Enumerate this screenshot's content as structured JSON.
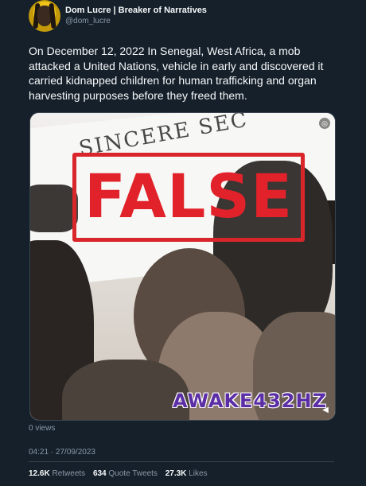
{
  "author": {
    "display_name": "Dom Lucre | Breaker of Narratives",
    "handle": "@dom_lucre"
  },
  "tweet": {
    "text": "On December 12, 2022 In Senegal, West Africa, a mob attacked a United Nations, vehicle in early and discovered it carried kidnapped children for human trafficking and organ harvesting purposes before they freed them."
  },
  "media": {
    "stamp_text": "FALSE",
    "watermark_text": "AWAKE432HZ",
    "background_sign_text": "SINCERE SEC",
    "stamp_color": "#d9262b",
    "watermark_color": "#5b2ea6"
  },
  "meta": {
    "views": "0 views",
    "timestamp": "04:21 · 27/09/2023"
  },
  "stats": {
    "retweets_count": "12.6K",
    "retweets_label": "Retweets",
    "quotes_count": "634",
    "quotes_label": "Quote Tweets",
    "likes_count": "27.3K",
    "likes_label": "Likes"
  }
}
